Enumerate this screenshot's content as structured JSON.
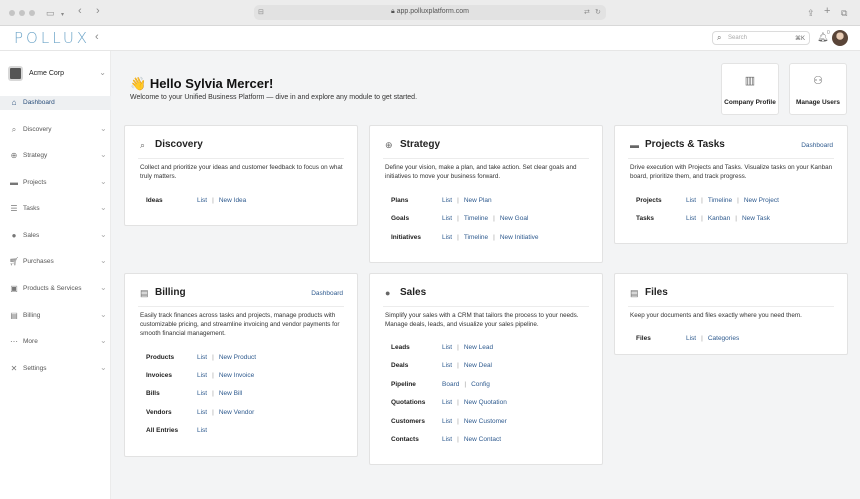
{
  "browser": {
    "url": "app.polluxplatform.com"
  },
  "app": {
    "logo": "POLLUX",
    "search_placeholder": "Search",
    "search_shortcut": "⌘K",
    "notif_count": "0"
  },
  "sidebar": {
    "org": "Acme Corp",
    "items": [
      {
        "label": "Dashboard",
        "icon": "home-icon"
      },
      {
        "label": "Discovery",
        "icon": "search-icon"
      },
      {
        "label": "Strategy",
        "icon": "globe-icon"
      },
      {
        "label": "Projects",
        "icon": "briefcase-icon"
      },
      {
        "label": "Tasks",
        "icon": "list-icon"
      },
      {
        "label": "Sales",
        "icon": "dollar-icon"
      },
      {
        "label": "Purchases",
        "icon": "cart-icon"
      },
      {
        "label": "Products & Services",
        "icon": "box-icon"
      },
      {
        "label": "Billing",
        "icon": "billing-icon"
      },
      {
        "label": "More",
        "icon": "ellipsis-icon"
      },
      {
        "label": "Settings",
        "icon": "wrench-icon"
      }
    ]
  },
  "welcome": {
    "emoji": "👋",
    "title": "Hello Sylvia Mercer!",
    "subtitle": "Welcome to your Unified Business Platform — dive in and explore any module to get started."
  },
  "quick_actions": [
    {
      "label": "Company Profile",
      "icon": "building-icon"
    },
    {
      "label": "Manage Users",
      "icon": "users-icon"
    }
  ],
  "cards": {
    "discovery": {
      "title": "Discovery",
      "desc": "Collect and prioritize your ideas and customer feedback to focus on what truly matters.",
      "rows": [
        {
          "label": "Ideas",
          "links": [
            "List",
            "New Idea"
          ]
        }
      ]
    },
    "strategy": {
      "title": "Strategy",
      "desc": "Define your vision, make a plan, and take action. Set clear goals and initiatives to move your business forward.",
      "rows": [
        {
          "label": "Plans",
          "links": [
            "List",
            "New Plan"
          ]
        },
        {
          "label": "Goals",
          "links": [
            "List",
            "Timeline",
            "New Goal"
          ]
        },
        {
          "label": "Initiatives",
          "links": [
            "List",
            "Timeline",
            "New Initiative"
          ]
        }
      ]
    },
    "projects": {
      "title": "Projects & Tasks",
      "dashboard": "Dashboard",
      "desc": "Drive execution with Projects and Tasks. Visualize tasks on your Kanban board, prioritize them, and track progress.",
      "rows": [
        {
          "label": "Projects",
          "links": [
            "List",
            "Timeline",
            "New Project"
          ]
        },
        {
          "label": "Tasks",
          "links": [
            "List",
            "Kanban",
            "New Task"
          ]
        }
      ]
    },
    "billing": {
      "title": "Billing",
      "dashboard": "Dashboard",
      "desc": "Easily track finances across tasks and projects, manage products with customizable pricing, and streamline invoicing and vendor payments for smooth financial management.",
      "rows": [
        {
          "label": "Products",
          "links": [
            "List",
            "New Product"
          ]
        },
        {
          "label": "Invoices",
          "links": [
            "List",
            "New Invoice"
          ]
        },
        {
          "label": "Bills",
          "links": [
            "List",
            "New Bill"
          ]
        },
        {
          "label": "Vendors",
          "links": [
            "List",
            "New Vendor"
          ]
        },
        {
          "label": "All Entries",
          "links": [
            "List"
          ]
        }
      ]
    },
    "sales": {
      "title": "Sales",
      "desc": "Simplify your sales with a CRM that tailors the process to your needs. Manage deals, leads, and visualize your sales pipeline.",
      "rows": [
        {
          "label": "Leads",
          "links": [
            "List",
            "New Lead"
          ]
        },
        {
          "label": "Deals",
          "links": [
            "List",
            "New Deal"
          ]
        },
        {
          "label": "Pipeline",
          "links": [
            "Board",
            "Config"
          ]
        },
        {
          "label": "Quotations",
          "links": [
            "List",
            "New Quotation"
          ]
        },
        {
          "label": "Customers",
          "links": [
            "List",
            "New Customer"
          ]
        },
        {
          "label": "Contacts",
          "links": [
            "List",
            "New Contact"
          ]
        }
      ]
    },
    "files": {
      "title": "Files",
      "desc": "Keep your documents and files exactly where you need them.",
      "rows": [
        {
          "label": "Files",
          "links": [
            "List",
            "Categories"
          ]
        }
      ]
    }
  }
}
